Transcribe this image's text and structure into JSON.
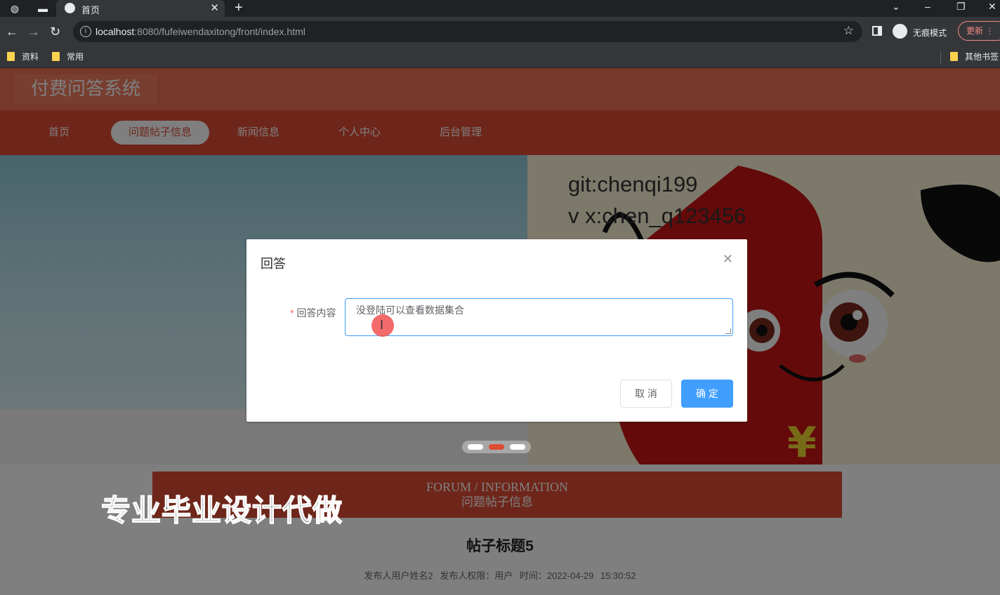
{
  "browser": {
    "tab_title": "首页",
    "url_host": "localhost",
    "url_rest": ":8080/fufeiwendaxitong/front/index.html",
    "incognito_label": "无痕模式",
    "update_label": "更新",
    "bookmarks": [
      "资料",
      "常用"
    ],
    "other_bookmarks": "其他书签"
  },
  "site": {
    "title": "付费问答系统",
    "nav": [
      "首页",
      "问题帖子信息",
      "新闻信息",
      "个人中心",
      "后台管理"
    ],
    "active_nav_index": 1,
    "banner_text": [
      "git:chenqi199",
      "v x:chen_q123456"
    ]
  },
  "content": {
    "forum_en": "FORUM / INFORMATION",
    "forum_cn": "问题帖子信息",
    "watermark": "专业毕业设计代做",
    "post_title": "帖子标题5",
    "post_meta": "发布人用户姓名2  发布人权限：用户  时间：2022-04-29 15:30:52"
  },
  "dialog": {
    "title": "回答",
    "label": "回答内容",
    "textarea_value": "没登陆可以查看数据集合",
    "cancel_label": "取 消",
    "ok_label": "确 定"
  },
  "colors": {
    "header": "#ed7154",
    "nav": "#dd4c34",
    "primary": "#409eff"
  }
}
